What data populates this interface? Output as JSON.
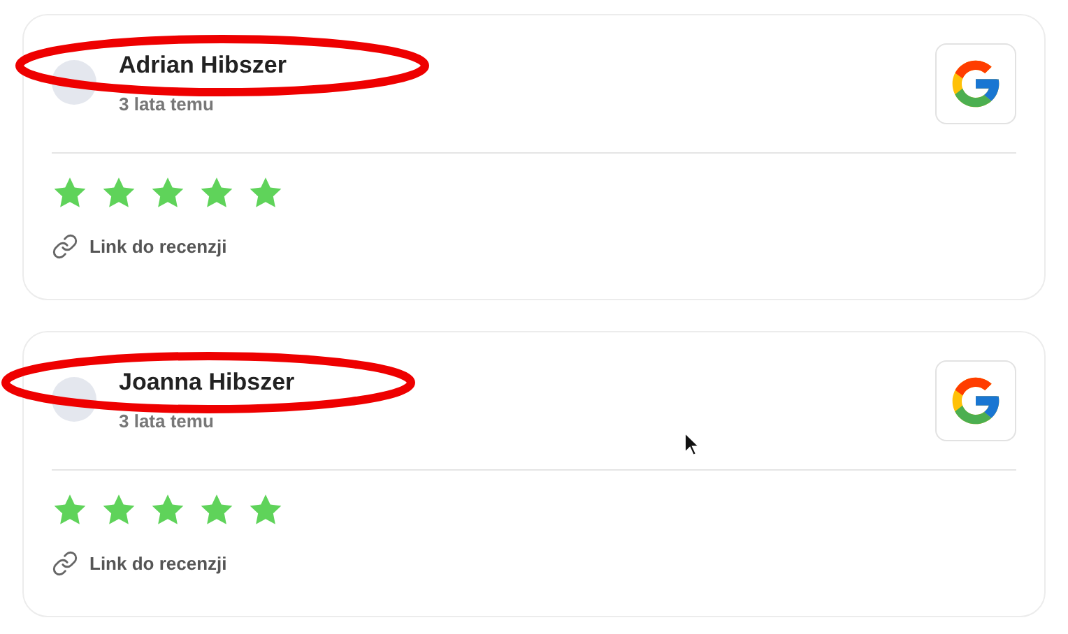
{
  "reviews": [
    {
      "name": "Adrian Hibszer",
      "time": "3 lata temu",
      "stars": 5,
      "link": "Link do recenzji",
      "highlighted": true
    },
    {
      "name": "Joanna Hibszer",
      "time": "3 lata temu",
      "stars": 5,
      "link": "Link do recenzji",
      "highlighted": true
    }
  ]
}
